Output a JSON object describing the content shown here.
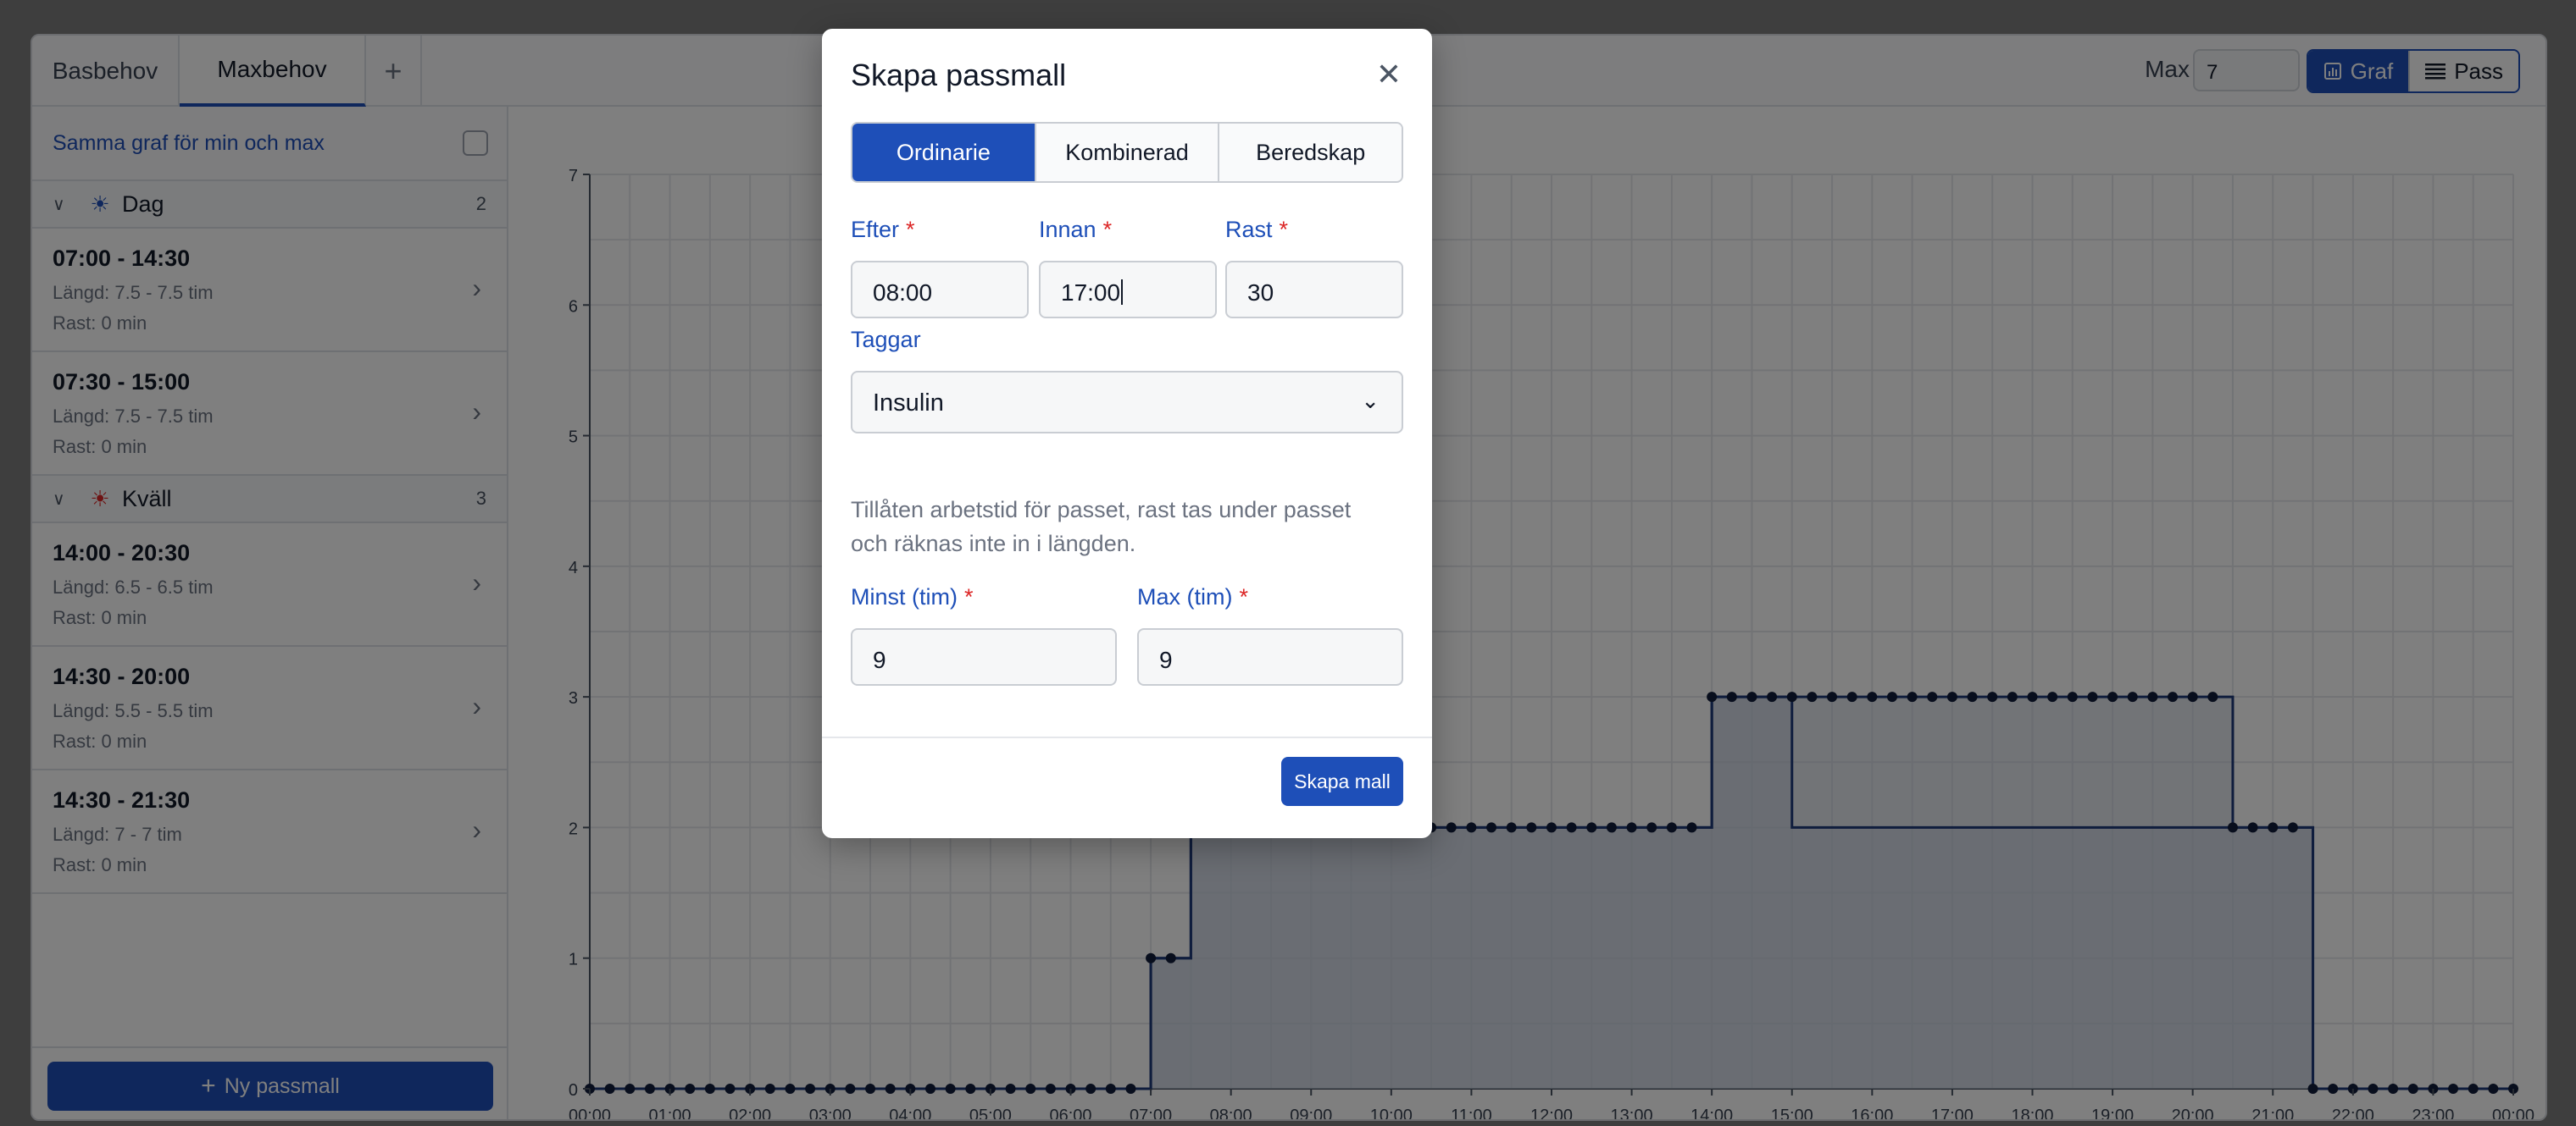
{
  "tabs": [
    {
      "label": "Basbehov"
    },
    {
      "label": "Maxbehov"
    },
    {
      "label": "+"
    }
  ],
  "toolbar": {
    "max_label": "Max",
    "max_value": "7",
    "view_graph_label": "Graf",
    "view_pass_label": "Pass"
  },
  "sidebar": {
    "same_graph_label": "Samma graf för min och max",
    "groups": [
      {
        "name": "Dag",
        "icon": "sun-icon",
        "count": "2",
        "shifts": [
          {
            "time": "07:00 - 14:30",
            "length": "Längd: 7.5 - 7.5 tim",
            "break": "Rast: 0 min"
          },
          {
            "time": "07:30 - 15:00",
            "length": "Längd: 7.5 - 7.5 tim",
            "break": "Rast: 0 min"
          }
        ]
      },
      {
        "name": "Kväll",
        "icon": "sunset-icon",
        "count": "3",
        "shifts": [
          {
            "time": "14:00 - 20:30",
            "length": "Längd: 6.5 - 6.5 tim",
            "break": "Rast: 0 min"
          },
          {
            "time": "14:30 - 20:00",
            "length": "Längd: 5.5 - 5.5 tim",
            "break": "Rast: 0 min"
          },
          {
            "time": "14:30 - 21:30",
            "length": "Längd: 7 - 7 tim",
            "break": "Rast: 0 min"
          }
        ]
      }
    ],
    "new_template_label": "Ny passmall"
  },
  "modal": {
    "title": "Skapa passmall",
    "tabs": [
      "Ordinarie",
      "Kombinerad",
      "Beredskap"
    ],
    "active_tab": "Ordinarie",
    "fields": {
      "efter_label": "Efter",
      "efter_value": "08:00",
      "innan_label": "Innan",
      "innan_value": "17:00",
      "rast_label": "Rast",
      "rast_value": "30",
      "required_mark": "*",
      "taggar_label": "Taggar",
      "taggar_value": "Insulin",
      "help_text": "Tillåten arbetstid för passet, rast tas under passet och räknas inte in i längden.",
      "minst_label": "Minst (tim)",
      "minst_value": "9",
      "max_label": "Max (tim)",
      "max_value": "9"
    },
    "create_button_label": "Skapa mall"
  },
  "colors": {
    "accent": "#1e4fb8",
    "chart_line": "#1f3a7a",
    "chart_fill": "#c4ccdc",
    "required": "#dc2626"
  },
  "chart_data": {
    "type": "area",
    "step": true,
    "x_unit": "hour",
    "x_ticks": [
      "00:00",
      "01:00",
      "02:00",
      "03:00",
      "04:00",
      "05:00",
      "06:00",
      "07:00",
      "08:00",
      "09:00",
      "10:00",
      "11:00",
      "12:00",
      "13:00",
      "14:00",
      "15:00",
      "16:00",
      "17:00",
      "18:00",
      "19:00",
      "20:00",
      "21:00",
      "22:00",
      "23:00",
      "00:00"
    ],
    "y_ticks": [
      "0",
      "1",
      "2",
      "3",
      "4",
      "5",
      "6",
      "7"
    ],
    "ylim": [
      0,
      7
    ],
    "grid": true,
    "series": [
      {
        "points": [
          [
            0,
            0
          ],
          [
            7,
            1
          ],
          [
            7.5,
            2
          ],
          [
            14,
            3
          ],
          [
            15,
            2
          ],
          [
            20.5,
            2
          ],
          [
            21.5,
            0
          ],
          [
            24,
            0
          ]
        ]
      },
      {
        "points": [
          [
            0,
            0
          ],
          [
            7,
            1
          ],
          [
            7.5,
            2
          ],
          [
            14,
            3
          ],
          [
            20.5,
            2
          ],
          [
            21.5,
            0
          ],
          [
            24,
            0
          ]
        ]
      }
    ]
  }
}
